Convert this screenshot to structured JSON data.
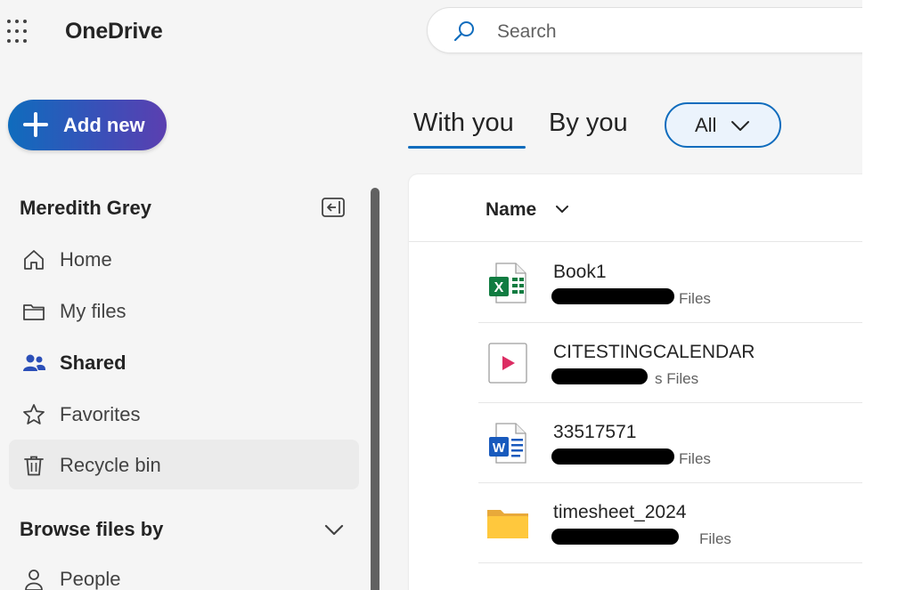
{
  "app": {
    "name": "OneDrive"
  },
  "search": {
    "placeholder": "Search"
  },
  "add_new": {
    "label": "Add new"
  },
  "user": {
    "name": "Meredith Grey"
  },
  "nav": [
    {
      "label": "Home",
      "icon": "home-icon"
    },
    {
      "label": "My files",
      "icon": "folder-icon"
    },
    {
      "label": "Shared",
      "icon": "people-icon"
    },
    {
      "label": "Favorites",
      "icon": "star-icon"
    },
    {
      "label": "Recycle bin",
      "icon": "trash-icon"
    }
  ],
  "browse": {
    "label": "Browse files by"
  },
  "browse_items": [
    {
      "label": "People",
      "icon": "person-icon"
    }
  ],
  "tabs": [
    {
      "label": "With you",
      "selected": true
    },
    {
      "label": "By you",
      "selected": false
    }
  ],
  "filter": {
    "label": "All"
  },
  "list": {
    "column": "Name",
    "rows": [
      {
        "name": "Book1",
        "sub": "Files",
        "icon": "excel-icon"
      },
      {
        "name": "CITESTINGCALENDAR",
        "sub": "s Files",
        "icon": "stream-video-icon"
      },
      {
        "name": "33517571",
        "sub": "Files",
        "icon": "word-icon"
      },
      {
        "name": "timesheet_2024",
        "sub": "Files",
        "icon": "folder-icon"
      }
    ]
  },
  "colors": {
    "accent": "#0f6cbd",
    "shared_icon": "#2b4fb8",
    "excel": "#107c41",
    "word": "#185abd",
    "folder": "#ffc83d",
    "video": "#dc2d63"
  }
}
